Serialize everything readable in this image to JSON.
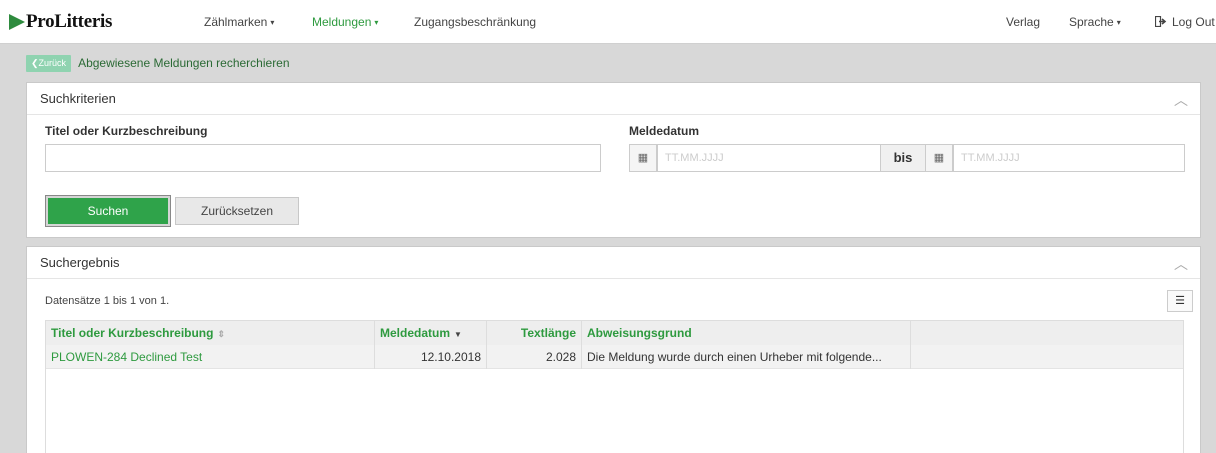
{
  "brand": {
    "logo_text": "ProLitteris"
  },
  "nav": {
    "items": [
      {
        "label": "Zählmarken",
        "caret": "▾"
      },
      {
        "label": "Meldungen",
        "caret": "▾"
      },
      {
        "label": "Zugangsbeschränkung"
      }
    ],
    "right": [
      {
        "label": "Verlag"
      },
      {
        "label": "Sprache",
        "caret": "▾"
      },
      {
        "label": "Log Out",
        "icon": "sign-out-icon"
      }
    ],
    "active_color": "#2e9a3f"
  },
  "breadcrumb": {
    "back_label": "Zurück",
    "title": "Abgewiesene Meldungen recherchieren"
  },
  "search": {
    "title": "Suchkriterien",
    "title_field_label": "Titel oder Kurzbeschreibung",
    "title_field_value": "",
    "date_label": "Meldedatum",
    "date_from_placeholder": "TT.MM.JJJJ",
    "date_to_placeholder": "TT.MM.JJJJ",
    "bis_label": "bis",
    "search_button": "Suchen",
    "reset_button": "Zurücksetzen"
  },
  "results": {
    "title": "Suchergebnis",
    "count_text": "Datensätze 1 bis 1 von 1.",
    "columns": [
      "Titel oder Kurzbeschreibung",
      "Meldedatum",
      "Textlänge",
      "Abweisungsgrund"
    ],
    "rows": [
      {
        "title": "PLOWEN-284 Declined Test",
        "date": "12.10.2018",
        "length": "2.028",
        "reason": "Die Meldung wurde durch einen Urheber mit folgende..."
      }
    ]
  },
  "colors": {
    "accent": "#2fa34a",
    "link": "#2e9a3f",
    "back_button": "#8fd3b0"
  }
}
